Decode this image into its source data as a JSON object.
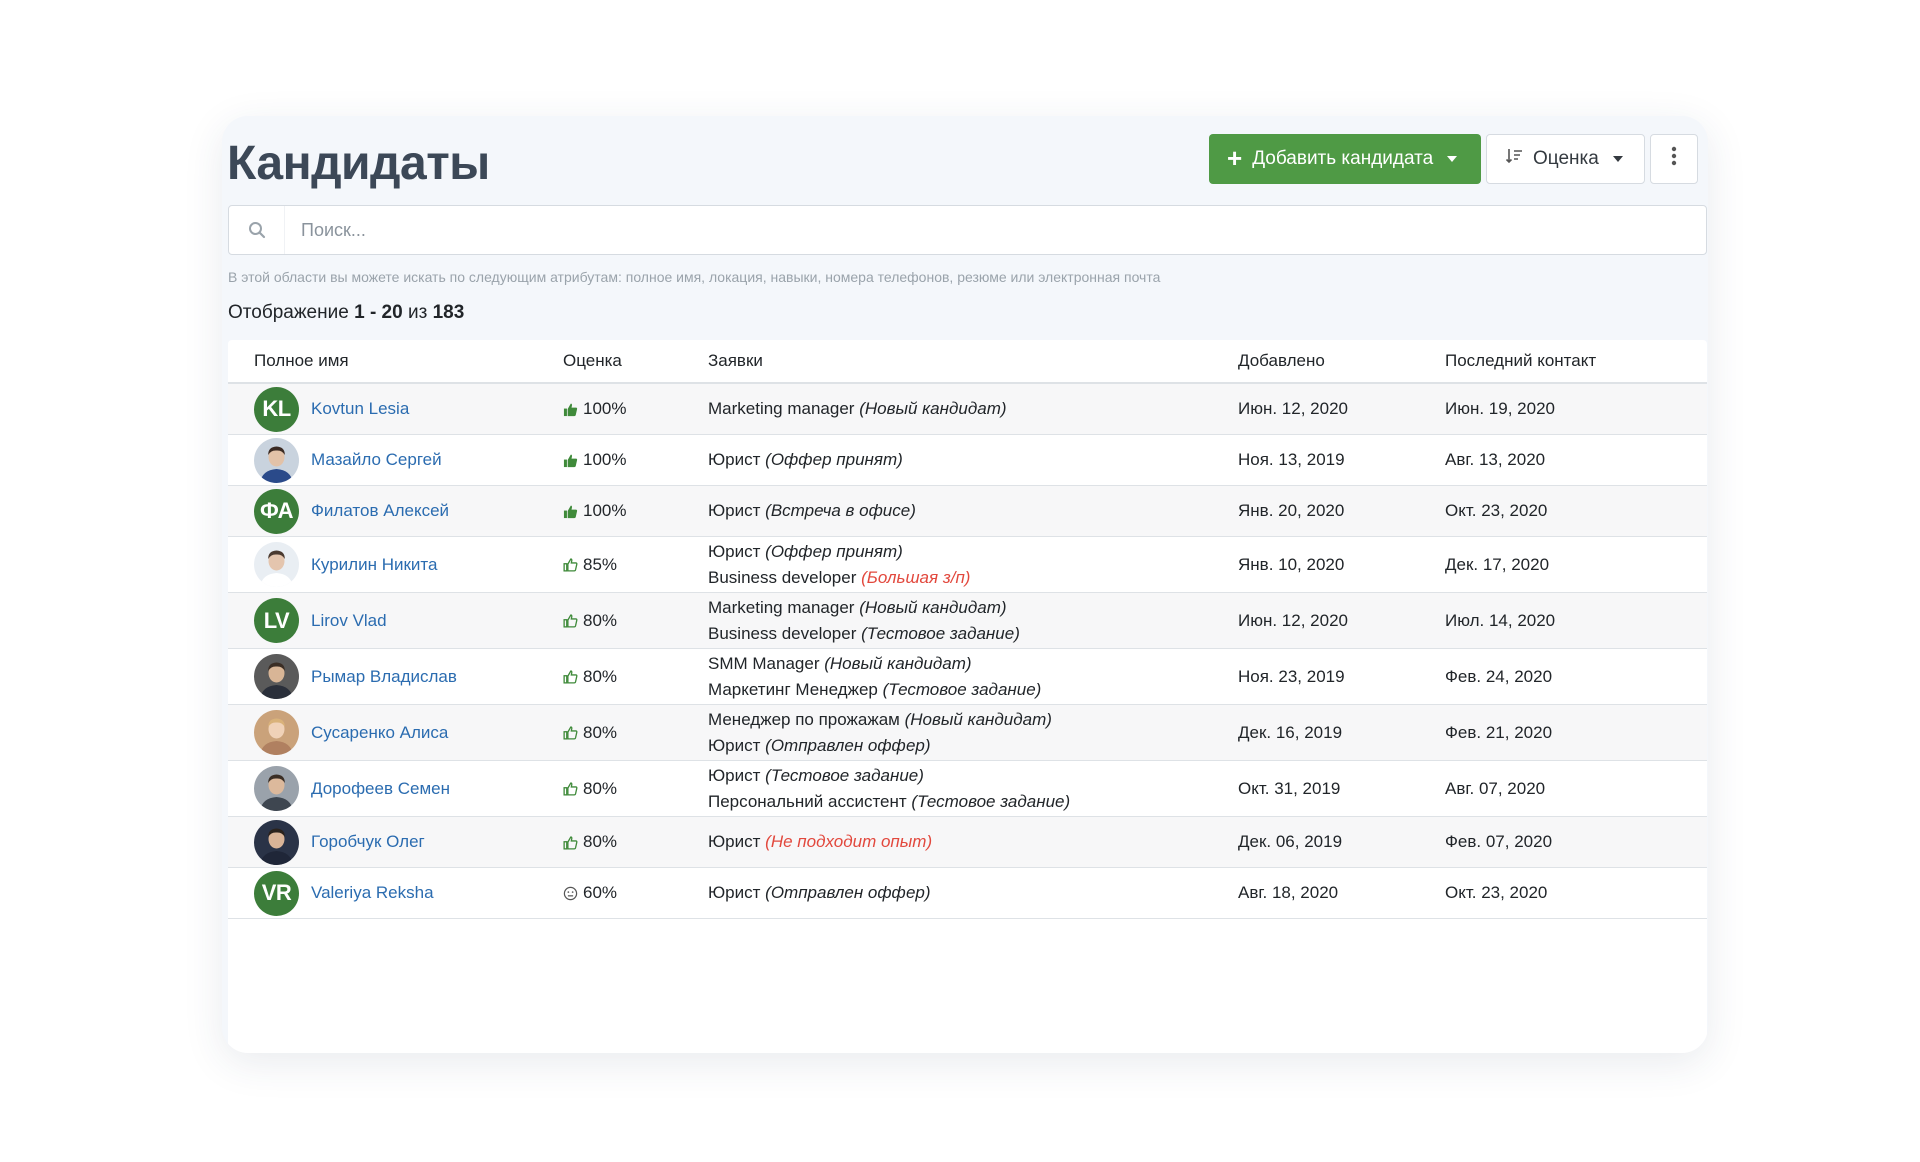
{
  "page": {
    "title": "Кандидаты",
    "add_button": "Добавить кандидата",
    "sort_button": "Оценка",
    "search_placeholder": "Поиск...",
    "search_hint": "В этой области вы можете искать по следующим атрибутам: полное имя, локация, навыки, номера телефонов, резюме или электронная почта",
    "count_prefix": "Отображение",
    "count_range": "1 - 20",
    "count_sep": "из",
    "count_total": "183"
  },
  "colors": {
    "accent_green": "#4f9a45",
    "avatar_green": "#3c7d3a",
    "link_blue": "#2b6cb0",
    "status_red": "#e2483d"
  },
  "table": {
    "headers": {
      "name": "Полное имя",
      "score": "Оценка",
      "apps": "Заявки",
      "added": "Добавлено",
      "contact": "Последний контакт"
    },
    "rows": [
      {
        "initials": "KL",
        "photo": false,
        "name": "Kovtun Lesia",
        "score_icon": "thumb-up-filled",
        "score": "100%",
        "apps": [
          {
            "job": "Marketing manager",
            "status": "(Новый кандидат)",
            "red": false
          }
        ],
        "added": "Июн. 12, 2020",
        "contact": "Июн. 19, 2020"
      },
      {
        "initials": "",
        "photo": true,
        "photo_tone": "blue-suit",
        "name": "Мазайло Сергей",
        "score_icon": "thumb-up-filled",
        "score": "100%",
        "apps": [
          {
            "job": "Юрист",
            "status": "(Оффер принят)",
            "red": false
          }
        ],
        "added": "Ноя. 13, 2019",
        "contact": "Авг. 13, 2020"
      },
      {
        "initials": "ФА",
        "photo": false,
        "name": "Филатов Алексей",
        "score_icon": "thumb-up-filled",
        "score": "100%",
        "apps": [
          {
            "job": "Юрист",
            "status": "(Встреча в офисе)",
            "red": false
          }
        ],
        "added": "Янв. 20, 2020",
        "contact": "Окт. 23, 2020"
      },
      {
        "initials": "",
        "photo": true,
        "photo_tone": "light",
        "name": "Курилин Никита",
        "score_icon": "thumb-up-outline",
        "score": "85%",
        "apps": [
          {
            "job": "Юрист",
            "status": "(Оффер принят)",
            "red": false
          },
          {
            "job": "Business developer",
            "status": "(Большая з/п)",
            "red": true
          }
        ],
        "added": "Янв. 10, 2020",
        "contact": "Дек. 17, 2020"
      },
      {
        "initials": "LV",
        "photo": false,
        "name": "Lirov Vlad",
        "score_icon": "thumb-up-outline",
        "score": "80%",
        "apps": [
          {
            "job": "Marketing manager",
            "status": "(Новый кандидат)",
            "red": false
          },
          {
            "job": "Business developer",
            "status": "(Тестовое задание)",
            "red": false
          }
        ],
        "added": "Июн. 12, 2020",
        "contact": "Июл. 14, 2020"
      },
      {
        "initials": "",
        "photo": true,
        "photo_tone": "dark",
        "name": "Рымар Владислав",
        "score_icon": "thumb-up-outline",
        "score": "80%",
        "apps": [
          {
            "job": "SMM Manager",
            "status": "(Новый кандидат)",
            "red": false
          },
          {
            "job": "Маркетинг Менеджер",
            "status": "(Тестовое задание)",
            "red": false
          }
        ],
        "added": "Ноя. 23, 2019",
        "contact": "Фев. 24, 2020"
      },
      {
        "initials": "",
        "photo": true,
        "photo_tone": "blonde",
        "name": "Сусаренко Алиса",
        "score_icon": "thumb-up-outline",
        "score": "80%",
        "apps": [
          {
            "job": "Менеджер по прожажам",
            "status": "(Новый кандидат)",
            "red": false
          },
          {
            "job": "Юрист",
            "status": "(Отправлен оффер)",
            "red": false
          }
        ],
        "added": "Дек. 16, 2019",
        "contact": "Фев. 21, 2020"
      },
      {
        "initials": "",
        "photo": true,
        "photo_tone": "grey",
        "name": "Дорофеев Семен",
        "score_icon": "thumb-up-outline",
        "score": "80%",
        "apps": [
          {
            "job": "Юрист",
            "status": "(Тестовое задание)",
            "red": false
          },
          {
            "job": "Персональний ассистент",
            "status": "(Тестовое задание)",
            "red": false
          }
        ],
        "added": "Окт. 31, 2019",
        "contact": "Авг. 07, 2020"
      },
      {
        "initials": "",
        "photo": true,
        "photo_tone": "navy",
        "name": "Горобчук Олег",
        "score_icon": "thumb-up-outline",
        "score": "80%",
        "apps": [
          {
            "job": "Юрист",
            "status": "(Не подходит опыт)",
            "red": true
          }
        ],
        "added": "Дек. 06, 2019",
        "contact": "Фев. 07, 2020"
      },
      {
        "initials": "VR",
        "photo": false,
        "name": "Valeriya Reksha",
        "score_icon": "neutral-face",
        "score": "60%",
        "apps": [
          {
            "job": "Юрист",
            "status": "(Отправлен оффер)",
            "red": false
          }
        ],
        "added": "Авг. 18, 2020",
        "contact": "Окт. 23, 2020"
      }
    ]
  }
}
